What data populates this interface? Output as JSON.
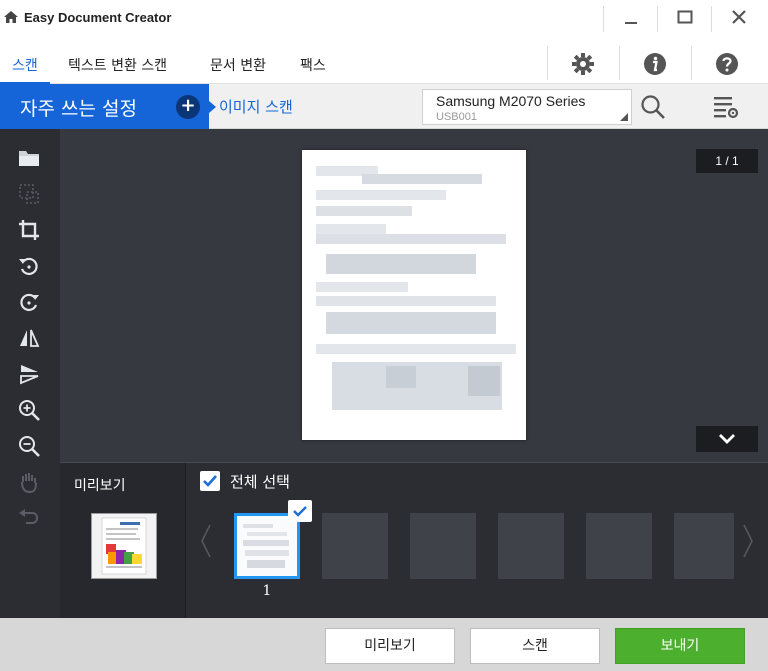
{
  "window": {
    "title": "Easy Document Creator"
  },
  "tabs": [
    {
      "label": "스캔",
      "active": true
    },
    {
      "label": "텍스트 변환 스캔",
      "active": false
    },
    {
      "label": "문서 변환",
      "active": false
    },
    {
      "label": "팩스",
      "active": false
    }
  ],
  "toolbar": {
    "preset_label": "자주 쓰는 설정",
    "add_symbol": "+",
    "breadcrumb": "이미지 스캔",
    "device_name": "Samsung M2070 Series",
    "device_port": "USB001"
  },
  "preview": {
    "page_counter": "1 / 1"
  },
  "thumbnails": {
    "mini_label": "미리보기",
    "select_all_label": "전체 선택",
    "select_all_checked": true,
    "pages": [
      {
        "number": "1",
        "selected": true
      }
    ]
  },
  "footer": {
    "preview_button": "미리보기",
    "scan_button": "스캔",
    "send_button": "보내기"
  },
  "colors": {
    "accent": "#1565d8",
    "send_green": "#4caf2e",
    "dark_panel": "#2b2d33",
    "preview_bg": "#363940"
  }
}
